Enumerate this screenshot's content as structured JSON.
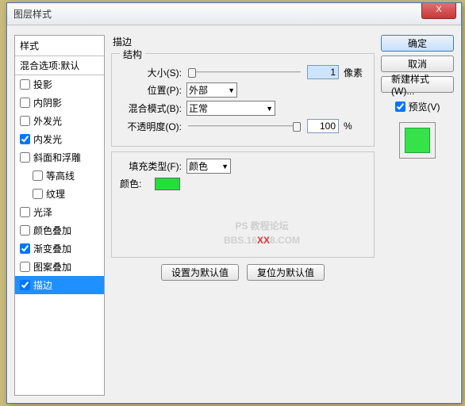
{
  "window": {
    "title": "图层样式",
    "close": "X"
  },
  "sidebar": {
    "header": "样式",
    "items": [
      {
        "label": "混合选项:默认",
        "checked": null
      },
      {
        "label": "投影",
        "checked": false
      },
      {
        "label": "内阴影",
        "checked": false
      },
      {
        "label": "外发光",
        "checked": false
      },
      {
        "label": "内发光",
        "checked": true
      },
      {
        "label": "斜面和浮雕",
        "checked": false
      },
      {
        "label": "等高线",
        "checked": false,
        "indent": true
      },
      {
        "label": "纹理",
        "checked": false,
        "indent": true
      },
      {
        "label": "光泽",
        "checked": false
      },
      {
        "label": "颜色叠加",
        "checked": false
      },
      {
        "label": "渐变叠加",
        "checked": true
      },
      {
        "label": "图案叠加",
        "checked": false
      },
      {
        "label": "描边",
        "checked": true,
        "selected": true
      }
    ]
  },
  "center": {
    "section_title": "描边",
    "structure_legend": "结构",
    "size_label": "大小(S):",
    "size_value": "1",
    "size_unit": "像素",
    "position_label": "位置(P):",
    "position_value": "外部",
    "blend_label": "混合模式(B):",
    "blend_value": "正常",
    "opacity_label": "不透明度(O):",
    "opacity_value": "100",
    "opacity_unit": "%",
    "fill_type_label": "填充类型(F):",
    "fill_type_value": "颜色",
    "color_label": "颜色:",
    "stroke_color": "#22e03a",
    "reset_default": "设置为默认值",
    "restore_default": "复位为默认值"
  },
  "right": {
    "ok": "确定",
    "cancel": "取消",
    "new_style": "新建样式(W)...",
    "preview": "预览(V)"
  },
  "watermark": {
    "line1": "PS 教程论坛",
    "line2a": "BBS.16",
    "line2x": "XX",
    "line2b": "8.COM"
  }
}
